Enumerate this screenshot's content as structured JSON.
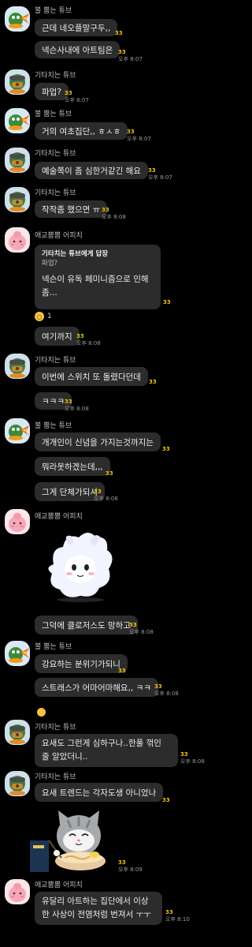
{
  "senders": {
    "bull": "불 뿜는 튜브",
    "guitar": "기타치는 튜브",
    "peach": "애교뿜뿜 어피치"
  },
  "messages": [
    {
      "text": "근데 네오플말구두,,",
      "unread": "33",
      "time": ""
    },
    {
      "text": "넥슨사내에 아트팀은",
      "unread": "33",
      "time": "오후 8:07"
    },
    {
      "text": "파업?",
      "unread": "33",
      "time": "오후 8:07"
    },
    {
      "text": "거의 여초집단,, ㅎㅅㅎ",
      "unread": "33",
      "time": "오후 8:07"
    },
    {
      "text": "예술쪽이 좀 심한거같긴 해요",
      "unread": "33",
      "time": "오후 8:07"
    },
    {
      "text": "작작좀 했으면 ㅠ",
      "unread": "33",
      "time": "오후 8:08"
    },
    {
      "text": "여기까지",
      "unread": "33",
      "time": "오후 8:08"
    },
    {
      "text": "이번에 스위치 또 돌렸다던데",
      "unread": "33",
      "time": ""
    },
    {
      "text": "ㅋㅋㅋ",
      "unread": "33",
      "time": "오후 8:08"
    },
    {
      "text": "개개인이 신념을 가지는것까지는",
      "unread": "33",
      "time": ""
    },
    {
      "text": "뭐라못하겠는데,,,",
      "unread": "33",
      "time": ""
    },
    {
      "text": "그게 단체가되서",
      "unread": "33",
      "time": "오후 8:08"
    },
    {
      "text": "그덕에 클로저스도 망하고",
      "unread": "33",
      "time": "오후 8:08"
    },
    {
      "text": "강요하는 분위기가되니",
      "unread": "33",
      "time": ""
    },
    {
      "text": "스트래스가 어마어마해요,, ㅋㅋ",
      "unread": "33",
      "time": "오후 8:08"
    },
    {
      "text": "요새도 그런게 심하구나..한풀 꺾인 줄 알았더니..",
      "unread": "33",
      "time": "오후 8:08"
    },
    {
      "text": "요새 트렌드는 각자도생 아니었나",
      "unread": "33",
      "time": ""
    },
    {
      "text": "유달리 아트하는 집단에서 이상한 사상이 전염처럼 번져서 ㅜㅜ",
      "unread": "33",
      "time": "오후 8:10"
    }
  ],
  "reply": {
    "header": "기타치는 튜브에게 답장",
    "quote": "파업?",
    "text": "넥슨이 유독 페미니즘으로 인해 좀...",
    "unread": "33",
    "reaction_count": "1"
  },
  "stickers": [
    {
      "unread": "33",
      "time": "오후 8:09",
      "icon": "cat-sticker"
    },
    {
      "icon": "white-creature-sticker"
    }
  ],
  "colors": {
    "background": "#000000",
    "bubble": "#2c2c2c",
    "unread": "#f1c40f"
  }
}
